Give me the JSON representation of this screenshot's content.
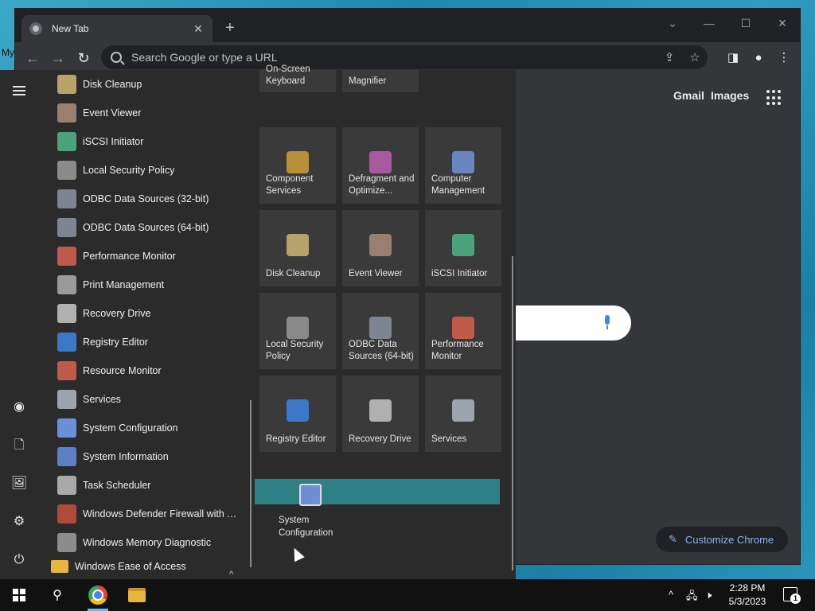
{
  "desktop": {
    "label": "My"
  },
  "browser": {
    "tab_title": "New Tab",
    "tab_close": "✕",
    "new_tab": "+",
    "controls": {
      "dropdown": "⌄",
      "minimize": "—",
      "maximize": "☐",
      "close": "✕"
    },
    "nav": {
      "back": "←",
      "forward": "→",
      "reload": "↻"
    },
    "omnibox_placeholder": "Search Google or type a URL",
    "omnibox_icons": {
      "share": "⇪",
      "bookmark": "☆"
    },
    "toolbar_right": {
      "sidepanel": "◨",
      "profile": "●",
      "menu": "⋮"
    },
    "ntp": {
      "gmail": "Gmail",
      "images": "Images",
      "customize": "Customize Chrome",
      "pencil": "✎"
    }
  },
  "start_menu": {
    "rail": {
      "hamburger": "menu",
      "user": "◉",
      "documents": "🗋",
      "pictures": "🖼",
      "settings": "⚙",
      "power": "⏻"
    },
    "apps": [
      {
        "label": "Disk Cleanup",
        "color": "#b9a36a"
      },
      {
        "label": "Event Viewer",
        "color": "#9a7f6e"
      },
      {
        "label": "iSCSI Initiator",
        "color": "#4aa37a"
      },
      {
        "label": "Local Security Policy",
        "color": "#8a8a8a"
      },
      {
        "label": "ODBC Data Sources (32-bit)",
        "color": "#7d8590"
      },
      {
        "label": "ODBC Data Sources (64-bit)",
        "color": "#7d8590"
      },
      {
        "label": "Performance Monitor",
        "color": "#c05a4a"
      },
      {
        "label": "Print Management",
        "color": "#9a9a9a"
      },
      {
        "label": "Recovery Drive",
        "color": "#b0b0b0"
      },
      {
        "label": "Registry Editor",
        "color": "#3b78c8"
      },
      {
        "label": "Resource Monitor",
        "color": "#c05a4a"
      },
      {
        "label": "Services",
        "color": "#9ea4ad"
      },
      {
        "label": "System Configuration",
        "color": "#6c8fd8"
      },
      {
        "label": "System Information",
        "color": "#5d7fc4"
      },
      {
        "label": "Task Scheduler",
        "color": "#a8a8a8"
      },
      {
        "label": "Windows Defender Firewall with Ad...",
        "color": "#b04a3a"
      },
      {
        "label": "Windows Memory Diagnostic",
        "color": "#8c8c8c"
      }
    ],
    "folder": {
      "label": "Windows Ease of Access",
      "chevron": "^"
    },
    "tiles_top": [
      {
        "label": "On-Screen Keyboard"
      },
      {
        "label": "Magnifier"
      }
    ],
    "tiles": [
      {
        "label": "Component Services",
        "color": "#b8903a"
      },
      {
        "label": "Defragment and Optimize...",
        "color": "#a85aa0"
      },
      {
        "label": "Computer Management",
        "color": "#6a86c0"
      },
      {
        "label": "Disk Cleanup",
        "color": "#b9a36a"
      },
      {
        "label": "Event Viewer",
        "color": "#9a7f6e"
      },
      {
        "label": "iSCSI Initiator",
        "color": "#4aa37a"
      },
      {
        "label": "Local Security Policy",
        "color": "#8a8a8a"
      },
      {
        "label": "ODBC Data Sources (64-bit)",
        "color": "#7d8590"
      },
      {
        "label": "Performance Monitor",
        "color": "#c05a4a"
      },
      {
        "label": "Registry Editor",
        "color": "#3b78c8"
      },
      {
        "label": "Recovery Drive",
        "color": "#b0b0b0"
      },
      {
        "label": "Services",
        "color": "#9ea4ad"
      }
    ],
    "dragging": {
      "label": "System Configuration"
    }
  },
  "taskbar": {
    "search_icon": "⚲",
    "tray": {
      "chevron": "^",
      "network": "🖧",
      "volume": "🕨"
    },
    "time": "2:28 PM",
    "date": "5/3/2023",
    "notifications": "1"
  }
}
